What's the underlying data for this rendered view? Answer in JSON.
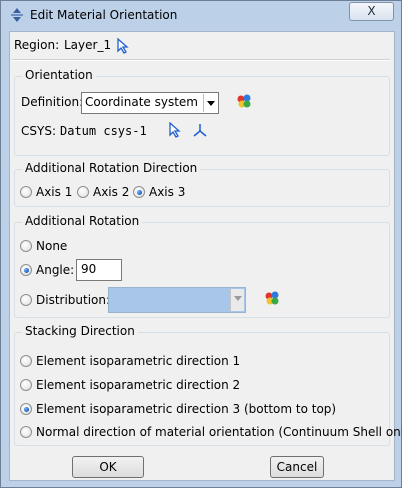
{
  "window": {
    "title": "Edit Material Orientation",
    "close_label": "X"
  },
  "region": {
    "label": "Region:",
    "value": "Layer_1"
  },
  "orientation": {
    "legend": "Orientation",
    "definition_label": "Definition:",
    "definition_value": "Coordinate system",
    "csys_label": "CSYS:",
    "csys_value": "Datum csys-1"
  },
  "rotation_direction": {
    "legend": "Additional Rotation Direction",
    "options": [
      "Axis 1",
      "Axis 2",
      "Axis 3"
    ],
    "selected": "Axis 3"
  },
  "rotation": {
    "legend": "Additional Rotation",
    "none_label": "None",
    "angle_label": "Angle:",
    "angle_value": "90",
    "distribution_label": "Distribution:",
    "selected": "Angle"
  },
  "stacking": {
    "legend": "Stacking Direction",
    "options": [
      "Element isoparametric direction 1",
      "Element isoparametric direction 2",
      "Element isoparametric direction 3 (bottom to top)",
      "Normal direction of material orientation (Continuum Shell only)"
    ],
    "selected_index": 2
  },
  "buttons": {
    "ok": "OK",
    "cancel": "Cancel"
  },
  "colors": {
    "title_bar": "#bcd0e8",
    "dialog_bg": "#f0f0f0",
    "disabled_combo": "#a8c6ea",
    "radio_selected": "#1c5fb8"
  },
  "icons": [
    "abaqus-app-icon",
    "select-arrow-icon",
    "create-field-icon",
    "datum-csys-icon"
  ]
}
